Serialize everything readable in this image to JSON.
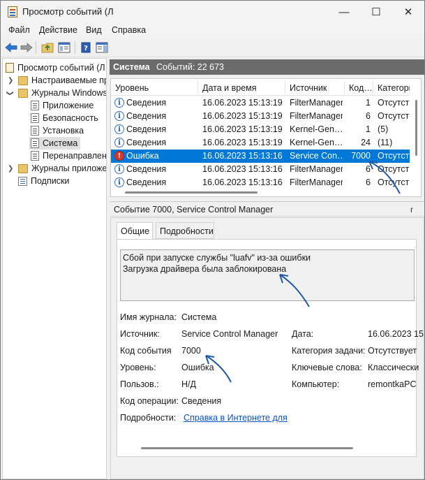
{
  "window": {
    "title": "Просмотр событий (Л"
  },
  "window_buttons": {
    "minimize": "—",
    "maximize": "☐",
    "close": "✕"
  },
  "menu": [
    "Файл",
    "Действие",
    "Вид",
    "Справка"
  ],
  "tree": {
    "root": "Просмотр событий (Л",
    "custom_views": "Настраиваемые пр",
    "windows_logs": "Журналы Windows",
    "logs": [
      "Приложение",
      "Безопасность",
      "Установка",
      "Система",
      "Перенаправлен"
    ],
    "app_logs": "Журналы приложе",
    "subscriptions": "Подписки"
  },
  "list_header": {
    "title": "Система",
    "count": "Событий: 22 673"
  },
  "columns": [
    "Уровень",
    "Дата и время",
    "Источник",
    "Код…",
    "Категори"
  ],
  "rows": [
    {
      "level": "Сведения",
      "datetime": "16.06.2023 15:13:19",
      "source": "FilterManager",
      "code": "1",
      "category": "Отсутств",
      "type": "info"
    },
    {
      "level": "Сведения",
      "datetime": "16.06.2023 15:13:19",
      "source": "FilterManager",
      "code": "6",
      "category": "Отсутств",
      "type": "info"
    },
    {
      "level": "Сведения",
      "datetime": "16.06.2023 15:13:19",
      "source": "Kernel-Gen…",
      "code": "1",
      "category": "(5)",
      "type": "info"
    },
    {
      "level": "Сведения",
      "datetime": "16.06.2023 15:13:19",
      "source": "Kernel-Gen…",
      "code": "24",
      "category": "(11)",
      "type": "info"
    },
    {
      "level": "Ошибка",
      "datetime": "16.06.2023 15:13:16",
      "source": "Service Con…",
      "code": "7000",
      "category": "Отсутств",
      "type": "error"
    },
    {
      "level": "Сведения",
      "datetime": "16.06.2023 15:13:16",
      "source": "FilterManager",
      "code": "6",
      "category": "Отсутств",
      "type": "info"
    },
    {
      "level": "Сведения",
      "datetime": "16.06.2023 15:13:16",
      "source": "FilterManager",
      "code": "6",
      "category": "Отсутств",
      "type": "info"
    }
  ],
  "details": {
    "header": "Событие 7000, Service Control Manager",
    "close_glyph": "r",
    "tabs": [
      "Общие",
      "Подробности"
    ],
    "message_line1": "Сбой при запуске службы \"luafv\" из-за ошибки",
    "message_line2": "Загрузка драйвера была заблокирована",
    "fields": {
      "log_name_label": "Имя журнала:",
      "log_name": "Система",
      "source_label": "Источник:",
      "source": "Service Control Manager",
      "date_label": "Дата:",
      "date": "16.06.2023 15",
      "event_id_label": "Код события",
      "event_id": "7000",
      "task_label": "Категория задачи:",
      "task": "Отсутствует",
      "level_label": "Уровень:",
      "level": "Ошибка",
      "keywords_label": "Ключевые слова:",
      "keywords": "Классически",
      "user_label": "Пользов.:",
      "user": "Н/Д",
      "computer_label": "Компьютер:",
      "computer": "remontkaPC",
      "opcode_label": "Код операции:",
      "opcode": "Сведения",
      "more_label": "Подробности:",
      "more_link": "Справка в Интернете для"
    }
  },
  "colors": {
    "selection": "#0078d7",
    "header_bar": "#6b6b6b",
    "arrow": "#1f5aa8",
    "link": "#0b53c2"
  }
}
